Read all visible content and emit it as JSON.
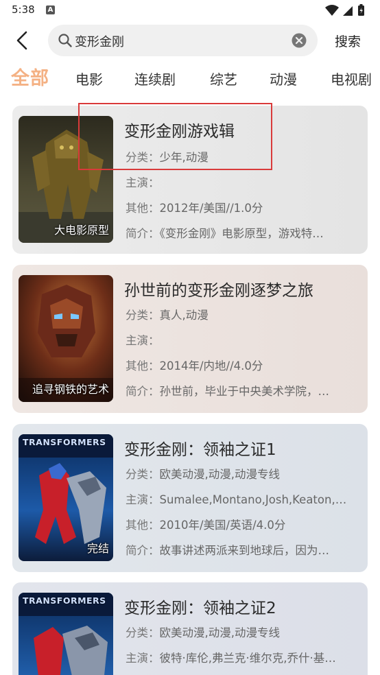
{
  "status_bar": {
    "time": "5:38",
    "notification_icon": "A",
    "icons": [
      "wifi-icon",
      "signal-icon",
      "battery-icon"
    ]
  },
  "search": {
    "back_icon": "chevron-left-icon",
    "query": "变形金刚",
    "search_icon": "search-icon",
    "clear_icon": "clear-icon",
    "button_label": "搜索"
  },
  "tabs": [
    {
      "label": "全部",
      "active": true
    },
    {
      "label": "电影",
      "active": false
    },
    {
      "label": "连续剧",
      "active": false
    },
    {
      "label": "综艺",
      "active": false
    },
    {
      "label": "动漫",
      "active": false
    },
    {
      "label": "电视剧",
      "active": false
    }
  ],
  "results": [
    {
      "title": "变形金刚游戏辑",
      "badge": "大电影原型",
      "category_label": "分类：",
      "category": "少年,动漫",
      "cast_label": "主演：",
      "cast": "",
      "other_label": "其他：",
      "other": "2012年/美国//1.0分",
      "intro_label": "简介：",
      "intro": "《变形金刚》电影原型，游戏特…",
      "card_color": "#e9e9e9"
    },
    {
      "title": "孙世前的变形金刚逐梦之旅",
      "badge": "追寻钢铁的艺术",
      "category_label": "分类：",
      "category": "真人,动漫",
      "cast_label": "主演：",
      "cast": "",
      "other_label": "其他：",
      "other": "2014年/内地//4.0分",
      "intro_label": "简介：",
      "intro": "孙世前，毕业于中央美术学院，…",
      "card_color": "#ede3df"
    },
    {
      "title": "变形金刚：领袖之证1",
      "badge": "完结",
      "poster_text": "TRANSFORMERS",
      "category_label": "分类：",
      "category": "欧美动漫,动漫,动漫专线",
      "cast_label": "主演：",
      "cast": "Sumalee,Montano,Josh,Keaton,K…",
      "other_label": "其他：",
      "other": "2010年/美国/英语/4.0分",
      "intro_label": "简介：",
      "intro": "故事讲述两派来到地球后，因为…",
      "card_color": "#dfe4ea"
    },
    {
      "title": "变形金刚：领袖之证2",
      "badge": "",
      "poster_text": "TRANSFORMERS",
      "category_label": "分类：",
      "category": "欧美动漫,动漫,动漫专线",
      "cast_label": "主演：",
      "cast": "彼特·库伦,弗兰克·维尔克,乔什·基…",
      "other_label": "其他：",
      "other": "",
      "intro_label": "简介：",
      "intro": "",
      "card_color": "#e0e3ea"
    }
  ],
  "colors": {
    "active_tab": "#f4b184",
    "highlight": "#d93a3a"
  }
}
